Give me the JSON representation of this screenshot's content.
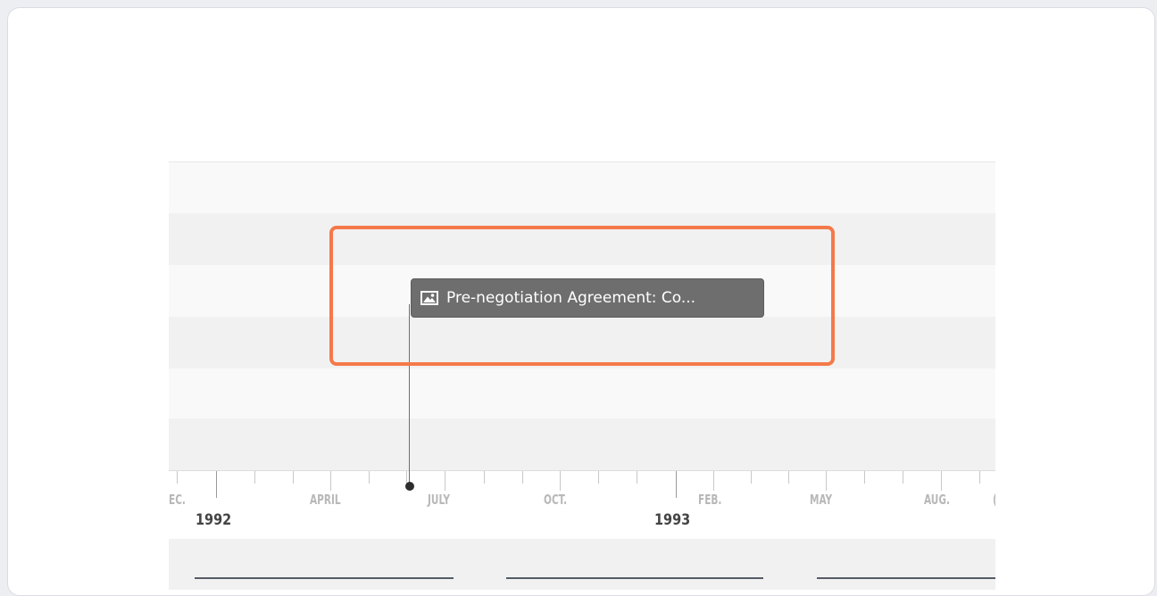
{
  "timeline": {
    "months": [
      "EC.",
      "APRIL",
      "JULY",
      "OCT.",
      "FEB.",
      "MAY",
      "AUG.",
      "("
    ],
    "years": [
      "1992",
      "1993"
    ],
    "event": {
      "icon": "image-icon",
      "title": "Pre-negotiation Agreement: Co..."
    }
  },
  "colors": {
    "highlight": "#f4794a",
    "event_bg": "#6e6e6e"
  }
}
